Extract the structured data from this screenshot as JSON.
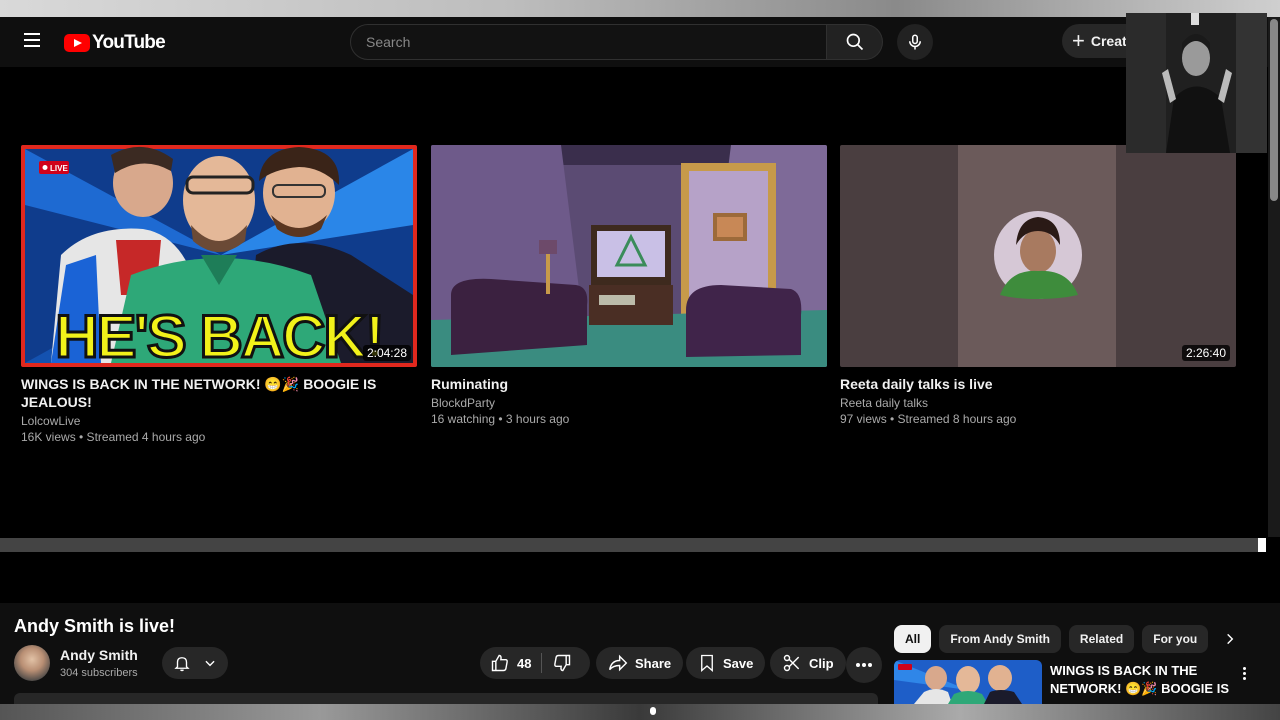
{
  "header": {
    "logo_text": "YouTube",
    "search_placeholder": "Search",
    "create_label": "Create"
  },
  "videos": [
    {
      "title": "WINGS IS BACK IN THE NETWORK! 😁🎉 BOOGIE IS JEALOUS!",
      "channel": "LolcowLive",
      "meta": "16K views • Streamed 4 hours ago",
      "duration": "2:04:28",
      "thumb_text": "HE'S BACK!",
      "live_badge": "LIVE"
    },
    {
      "title": "Ruminating",
      "channel": "BlockdParty",
      "meta": "16 watching • 3 hours ago",
      "duration": ""
    },
    {
      "title": "Reeta daily talks is live",
      "channel": "Reeta daily talks",
      "meta": "97 views • Streamed 8 hours ago",
      "duration": "2:26:40"
    }
  ],
  "watch": {
    "title": "Andy Smith is live!",
    "channel_name": "Andy Smith",
    "subscribers": "304 subscribers",
    "likes": "48",
    "share_label": "Share",
    "save_label": "Save",
    "clip_label": "Clip"
  },
  "chips": [
    "All",
    "From Andy Smith",
    "Related",
    "For you"
  ],
  "related": {
    "title": "WINGS IS BACK IN THE NETWORK! 😁🎉 BOOGIE IS ..."
  },
  "colors": {
    "brand_red": "#ff0000",
    "background": "#0f0f0f",
    "accent_yellow": "#f2f21a"
  }
}
